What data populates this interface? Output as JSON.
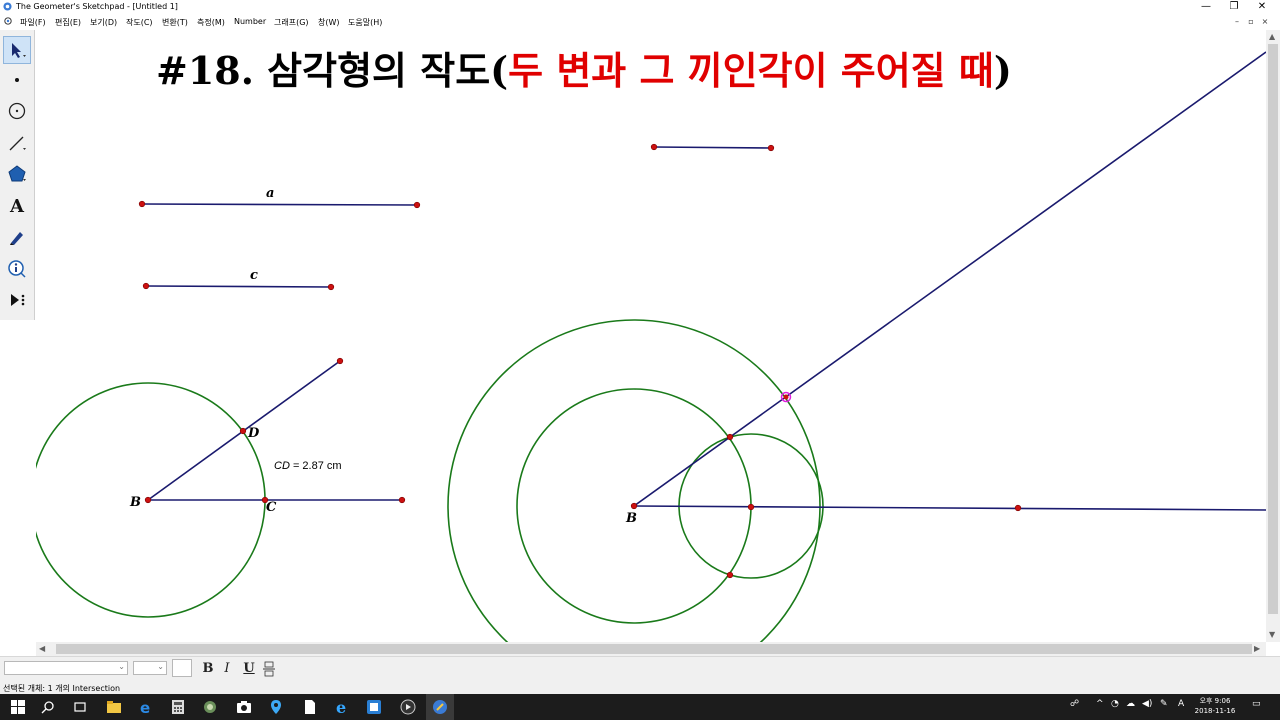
{
  "window": {
    "title": "The Geometer's Sketchpad - [Untitled 1]",
    "minimize": "—",
    "restore": "❐",
    "close": "✕"
  },
  "menu": {
    "items": [
      "파일(F)",
      "편집(E)",
      "보기(D)",
      "작도(C)",
      "변환(T)",
      "측정(M)",
      "Number",
      "그래프(G)",
      "창(W)",
      "도움말(H)"
    ],
    "mdi": [
      "–",
      "▫",
      "×"
    ]
  },
  "toolbox": {
    "tools": [
      "select-arrow-icon",
      "point-icon",
      "compass-icon",
      "straightedge-icon",
      "polygon-icon",
      "text-tool-icon",
      "marker-icon",
      "information-icon",
      "custom-tool-icon"
    ],
    "selected": "select-arrow-icon",
    "text_tool_glyph": "A"
  },
  "sketch": {
    "title_black_prefix": "#18. 삼각형의 작도(",
    "title_red": "두 변과 그 끼인각이 주어질 때",
    "title_black_suffix": ")",
    "segment_labels": {
      "a": "a",
      "c": "c"
    },
    "point_labels": {
      "B1": "B",
      "C": "C",
      "D": "D",
      "B2": "B"
    },
    "measurement": {
      "name": "CD",
      "value": "= 2.87 cm"
    },
    "colors": {
      "segment": "#1a1a6e",
      "circle": "#1a7a1a",
      "point": "#cc1111",
      "title_red": "#e00000"
    }
  },
  "formatbar": {
    "bold": "B",
    "italic": "I",
    "underline": "U"
  },
  "status": {
    "text": "선택된 개체: 1 개의 Intersection"
  },
  "taskbar": {
    "lang": "A",
    "time": "오후 9:06",
    "date": "2018-11-16"
  }
}
